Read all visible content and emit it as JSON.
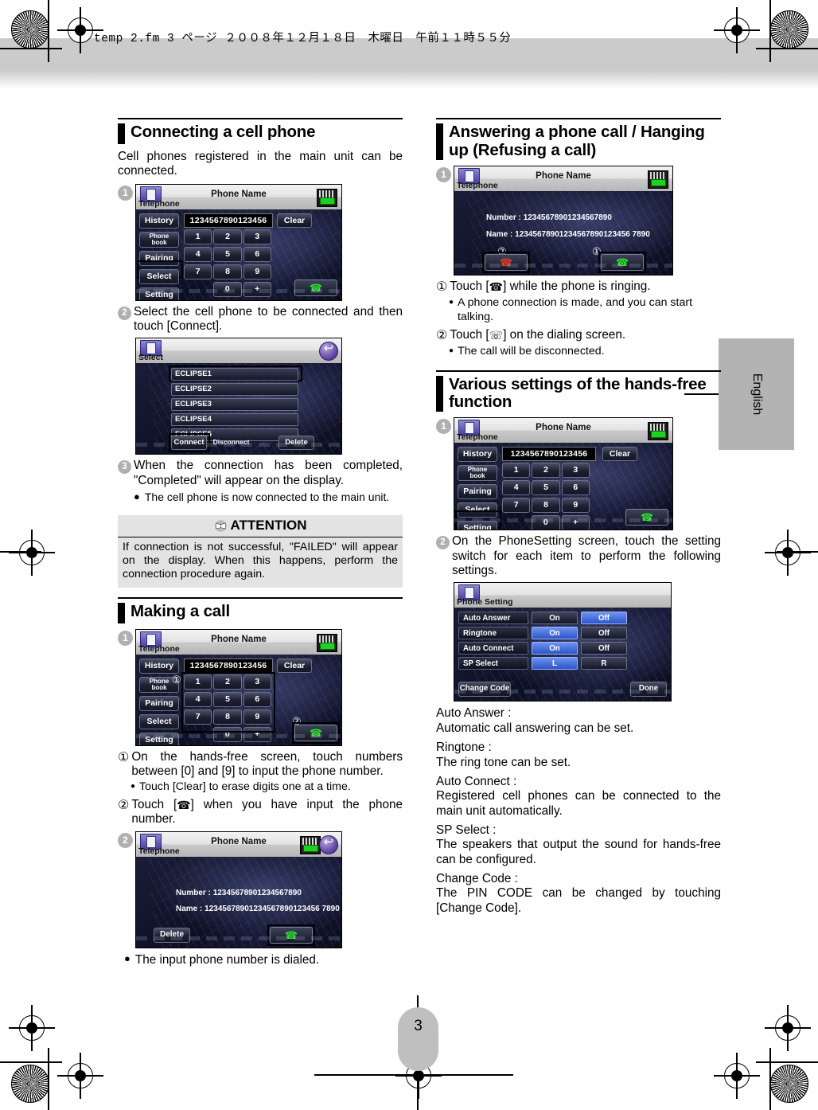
{
  "print_header": "temp 2.fm  3 ページ  ２００８年１２月１８日　木曜日　午前１１時５５分",
  "side_tab": {
    "label": "English"
  },
  "page_number": "3",
  "left_column": {
    "section1": {
      "heading": "Connecting a cell phone",
      "intro": "Cell phones registered in the main unit can be connected.",
      "figure1": {
        "callout": "1",
        "app_label": "Telephone",
        "title": "Phone Name",
        "left_keys": [
          "History",
          "Phone book",
          "Pairing",
          "Select",
          "Setting"
        ],
        "highlighted_key": "Select",
        "number_field": "1234567890123456",
        "clear_label": "Clear",
        "keys": [
          "1",
          "2",
          "3",
          "4",
          "5",
          "6",
          "7",
          "8",
          "9",
          "0",
          "+"
        ],
        "call_icon": "handset-green-icon"
      },
      "step2": {
        "num": "2",
        "text": "Select the cell phone to be connected and then touch [Connect]."
      },
      "figure2": {
        "app_label": "Select",
        "back_icon": "back-arrow-icon",
        "items": [
          "ECLIPSE1",
          "ECLIPSE2",
          "ECLIPSE3",
          "ECLIPSE4",
          "ECLIPSE5"
        ],
        "highlighted_item": "ECLIPSE1",
        "buttons": [
          "Connect",
          "Disconnect",
          "Delete"
        ],
        "highlighted_button": "Connect"
      },
      "step3": {
        "num": "3",
        "text": "When the connection has been completed, \"Completed\" will appear on the display.",
        "bullet": "The cell phone is now connected to the main unit."
      },
      "attention": {
        "title": "ATTENTION",
        "icon": "book-icon",
        "body": "If connection is not successful, \"FAILED\" will appear on the display. When this happens, perform the connection procedure again."
      }
    },
    "section2": {
      "heading": "Making a call",
      "figure1": {
        "callout": "1",
        "app_label": "Telephone",
        "title": "Phone Name",
        "left_keys": [
          "History",
          "Phone book",
          "Pairing",
          "Select",
          "Setting"
        ],
        "number_field": "1234567890123456",
        "clear_label": "Clear",
        "keys": [
          "1",
          "2",
          "3",
          "4",
          "5",
          "6",
          "7",
          "8",
          "9",
          "0",
          "+"
        ],
        "marker1": "①",
        "marker2": "②",
        "call_icon": "handset-green-icon"
      },
      "step1": {
        "num": "①",
        "text": "On the hands-free screen, touch numbers between [0] and [9] to input the phone number.",
        "bullet": "Touch [Clear] to erase digits one at a time."
      },
      "step2": {
        "num": "②",
        "text_before": "Touch [",
        "icon": "handset-green-icon",
        "text_after": "] when you have input the phone number."
      },
      "figure2": {
        "callout": "2",
        "app_label": "Telephone",
        "title": "Phone Name",
        "back_icon": "back-arrow-icon",
        "number_label": "Number :",
        "number_value": "12345678901234567890",
        "name_label": "Name    :",
        "name_value": "12345678901234567890123456 7890",
        "delete_label": "Delete",
        "call_icon": "handset-green-icon"
      },
      "closing_bullet": "The input phone number is dialed."
    }
  },
  "right_column": {
    "section1": {
      "heading": "Answering a phone call / Hanging up (Refusing a call)",
      "figure1": {
        "callout": "1",
        "app_label": "Telephone",
        "title": "Phone Name",
        "number_label": "Number :",
        "number_value": "12345678901234567890",
        "name_label": "Name    :",
        "name_value": "12345678901234567890123456 7890",
        "marker1": "①",
        "marker2": "②",
        "answer_icon": "handset-green-icon",
        "hangup_icon": "handset-red-icon"
      },
      "step1": {
        "num": "①",
        "text_before": "Touch [",
        "icon": "handset-green-icon",
        "text_after": "] while the phone is ringing.",
        "bullet": "A phone connection is made, and you can start talking."
      },
      "step2": {
        "num": "②",
        "text_before": "Touch [",
        "icon": "handset-black-icon",
        "text_after": "] on the dialing screen.",
        "bullet": "The call will be disconnected."
      }
    },
    "section2": {
      "heading": "Various settings of the hands-free function",
      "figure1": {
        "callout": "1",
        "app_label": "Telephone",
        "title": "Phone Name",
        "left_keys": [
          "History",
          "Phone book",
          "Pairing",
          "Select",
          "Setting"
        ],
        "highlighted_key": "Setting",
        "number_field": "1234567890123456",
        "clear_label": "Clear",
        "keys": [
          "1",
          "2",
          "3",
          "4",
          "5",
          "6",
          "7",
          "8",
          "9",
          "0",
          "+"
        ],
        "call_icon": "handset-green-icon"
      },
      "step2": {
        "num": "2",
        "text": "On the PhoneSetting screen, touch the setting switch for each item to perform the following settings."
      },
      "figure2": {
        "app_label": "Phone Setting",
        "rows": [
          {
            "label": "Auto Answer",
            "options": [
              "On",
              "Off"
            ],
            "selected": "Off"
          },
          {
            "label": "Ringtone",
            "options": [
              "On",
              "Off"
            ],
            "selected": "On"
          },
          {
            "label": "Auto Connect",
            "options": [
              "On",
              "Off"
            ],
            "selected": "On"
          },
          {
            "label": "SP Select",
            "options": [
              "L",
              "R"
            ],
            "selected": "L"
          }
        ],
        "change_code_label": "Change Code",
        "done_label": "Done"
      },
      "definitions": [
        {
          "term": "Auto Answer :",
          "desc": "Automatic call answering can be set."
        },
        {
          "term": "Ringtone :",
          "desc": "The ring tone can be set."
        },
        {
          "term": "Auto Connect :",
          "desc": "Registered cell phones can be connected to the main unit automatically."
        },
        {
          "term": "SP Select :",
          "desc": "The speakers that output the sound for hands-free can be configured."
        },
        {
          "term": "Change Code :",
          "desc": "The PIN CODE can be changed by touching [Change Code]."
        }
      ]
    }
  }
}
